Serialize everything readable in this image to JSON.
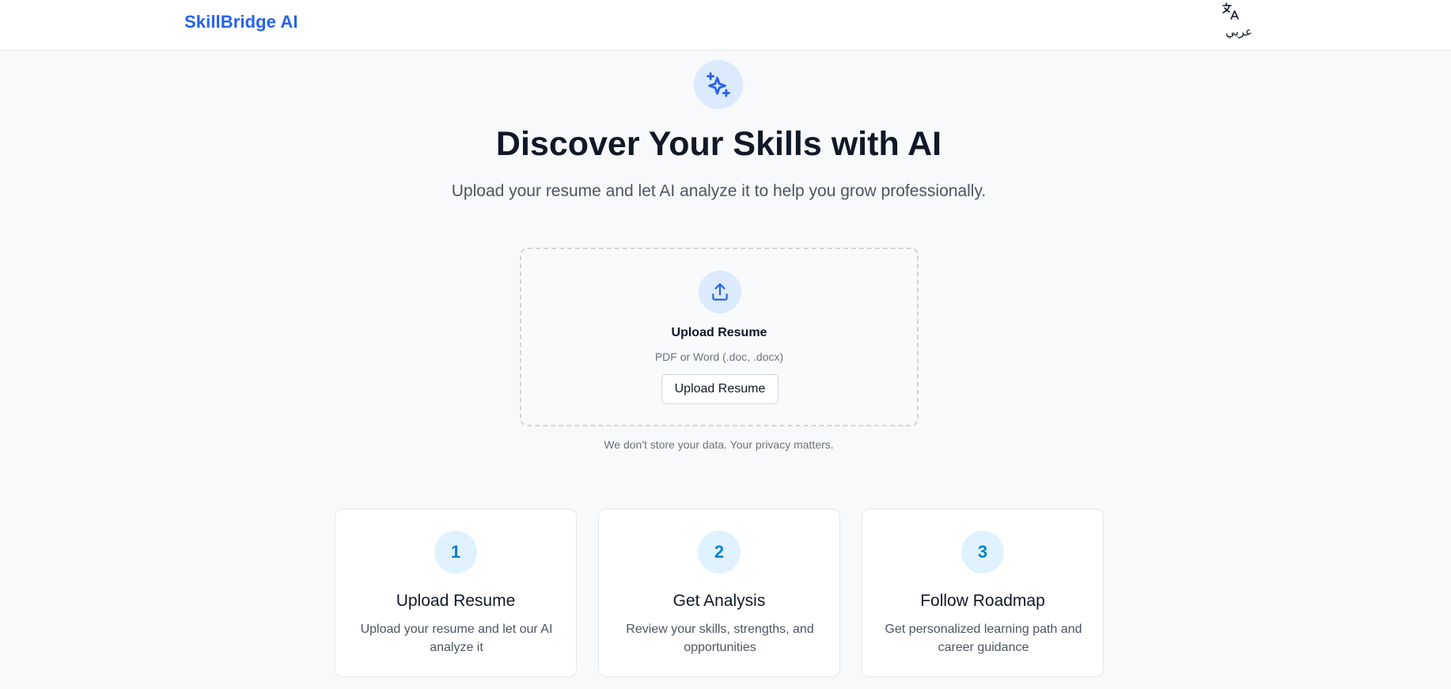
{
  "header": {
    "brand": "SkillBridge AI",
    "language_toggle": "عربي",
    "language_icon": "translate-icon"
  },
  "hero": {
    "icon": "sparkles-icon",
    "title": "Discover Your Skills with AI",
    "subtitle": "Upload your resume and let AI analyze it to help you grow professionally."
  },
  "upload": {
    "icon": "upload-icon",
    "title": "Upload Resume",
    "formats": "PDF or Word (.doc, .docx)",
    "button_label": "Upload Resume",
    "privacy_note": "We don't store your data. Your privacy matters."
  },
  "steps": [
    {
      "number": "1",
      "title": "Upload Resume",
      "description": "Upload your resume and let our AI analyze it"
    },
    {
      "number": "2",
      "title": "Get Analysis",
      "description": "Review your skills, strengths, and opportunities"
    },
    {
      "number": "3",
      "title": "Follow Roadmap",
      "description": "Get personalized learning path and career guidance"
    }
  ],
  "colors": {
    "brand": "#2563eb",
    "accent_light": "#dbeafe",
    "step_number": "#0284c7",
    "step_circle": "#e0f2fe",
    "background": "#f8f9fb"
  }
}
